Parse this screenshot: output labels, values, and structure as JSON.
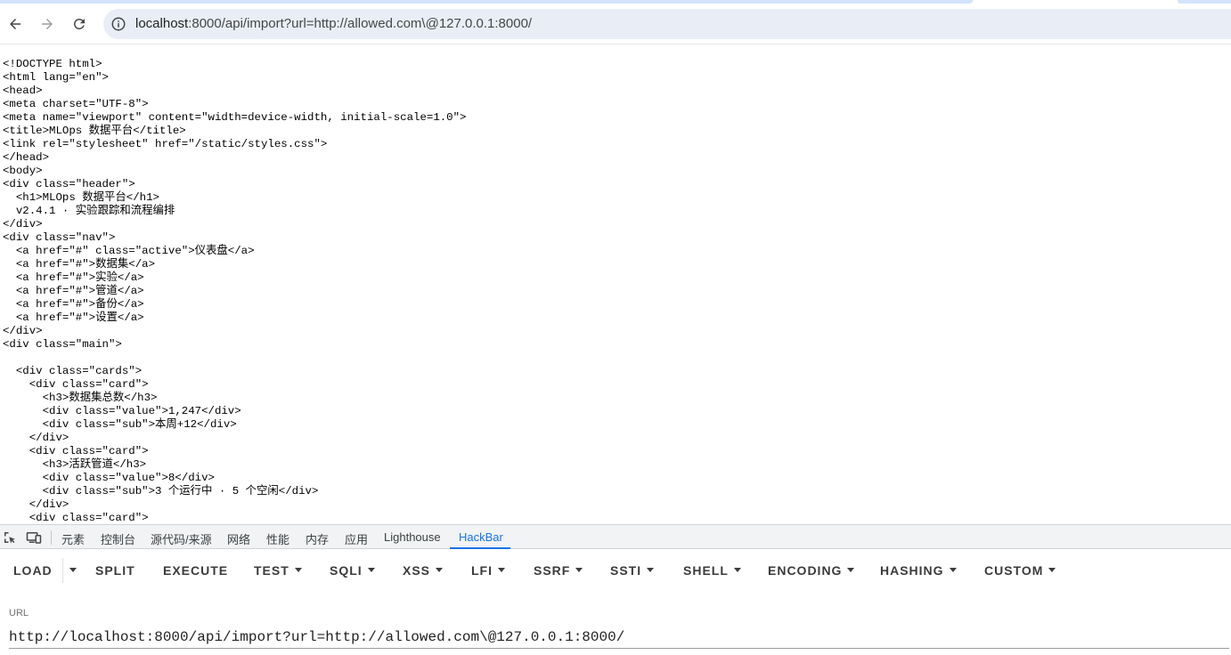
{
  "browser": {
    "url_host": "localhost",
    "url_rest": ":8000/api/import?url=http://allowed.com\\@127.0.0.1:8000/"
  },
  "page_source": {
    "lines": [
      "<!DOCTYPE html>",
      "<html lang=\"en\">",
      "<head>",
      "<meta charset=\"UTF-8\">",
      "<meta name=\"viewport\" content=\"width=device-width, initial-scale=1.0\">",
      "<title>MLOps 数据平台</title>",
      "<link rel=\"stylesheet\" href=\"/static/styles.css\">",
      "</head>",
      "<body>",
      "<div class=\"header\">",
      "  <h1>MLOps 数据平台</h1>",
      "  v2.4.1 · 实验跟踪和流程编排",
      "</div>",
      "<div class=\"nav\">",
      "  <a href=\"#\" class=\"active\">仪表盘</a>",
      "  <a href=\"#\">数据集</a>",
      "  <a href=\"#\">实验</a>",
      "  <a href=\"#\">管道</a>",
      "  <a href=\"#\">备份</a>",
      "  <a href=\"#\">设置</a>",
      "</div>",
      "<div class=\"main\">",
      "",
      "  <div class=\"cards\">",
      "    <div class=\"card\">",
      "      <h3>数据集总数</h3>",
      "      <div class=\"value\">1,247</div>",
      "      <div class=\"sub\">本周+12</div>",
      "    </div>",
      "    <div class=\"card\">",
      "      <h3>活跃管道</h3>",
      "      <div class=\"value\">8</div>",
      "      <div class=\"sub\">3 个运行中 · 5 个空闲</div>",
      "    </div>",
      "    <div class=\"card\">"
    ]
  },
  "devtools": {
    "tabs": [
      "元素",
      "控制台",
      "源代码/来源",
      "网络",
      "性能",
      "内存",
      "应用",
      "Lighthouse",
      "HackBar"
    ],
    "active_tab": "HackBar",
    "accent_color": "#1a73e8"
  },
  "hackbar": {
    "buttons": [
      {
        "label": "LOAD",
        "dropdown": false
      },
      {
        "label": "SPLIT",
        "dropdown": false
      },
      {
        "label": "EXECUTE",
        "dropdown": false
      },
      {
        "label": "TEST",
        "dropdown": true
      },
      {
        "label": "SQLI",
        "dropdown": true
      },
      {
        "label": "XSS",
        "dropdown": true
      },
      {
        "label": "LFI",
        "dropdown": true
      },
      {
        "label": "SSRF",
        "dropdown": true
      },
      {
        "label": "SSTI",
        "dropdown": true
      },
      {
        "label": "SHELL",
        "dropdown": true
      },
      {
        "label": "ENCODING",
        "dropdown": true
      },
      {
        "label": "HASHING",
        "dropdown": true
      },
      {
        "label": "CUSTOM",
        "dropdown": true
      }
    ],
    "url_label": "URL",
    "url_value": "http://localhost:8000/api/import?url=http://allowed.com\\@127.0.0.1:8000/"
  }
}
